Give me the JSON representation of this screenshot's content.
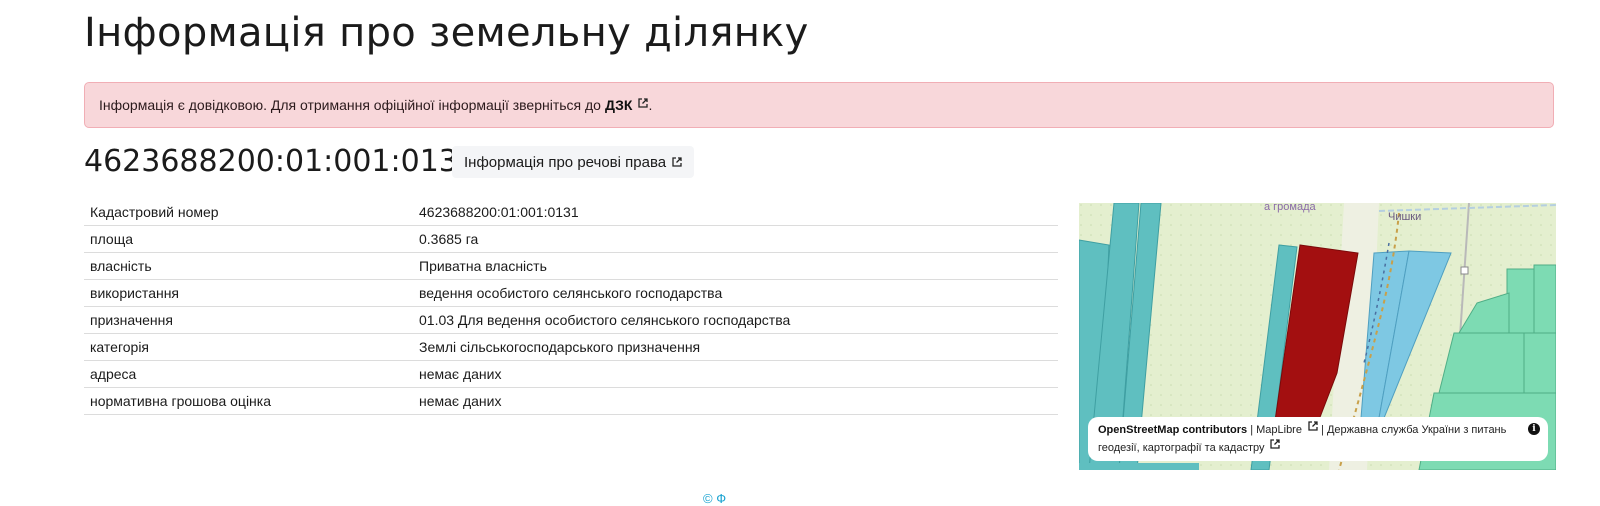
{
  "page": {
    "title": "Інформація про земельну ділянку"
  },
  "alert": {
    "text": "Інформація є довідковою. Для отримання офіційної інформації зверніться до",
    "link": "ДЗК",
    "tail": "."
  },
  "parcel": {
    "cadastral_number": "4623688200:01:001:0131",
    "rights_button": "Інформація про речові права"
  },
  "table": {
    "rows": [
      {
        "key": "Кадастровий номер",
        "value": "4623688200:01:001:0131"
      },
      {
        "key": "площа",
        "value": "0.3685 га"
      },
      {
        "key": "власність",
        "value": "Приватна власність"
      },
      {
        "key": "використання",
        "value": "ведення особистого селянського господарства"
      },
      {
        "key": "призначення",
        "value": "01.03 Для ведення особистого селянського господарства"
      },
      {
        "key": "категорія",
        "value": "Землі сільськогосподарського призначення"
      },
      {
        "key": "адреса",
        "value": "немає даних"
      },
      {
        "key": "нормативна грошова оцінка",
        "value": "немає даних"
      }
    ]
  },
  "map": {
    "label_hromada": "а громада",
    "label_village": "Чишки",
    "attribution": {
      "osm": "OpenStreetMap contributors",
      "sep1": "|",
      "maplibre": "MapLibre",
      "sep2": "|",
      "agency": "Державна служба України з питань геодезії, картографії та кадастру"
    },
    "info_icon": "i"
  },
  "footer": {
    "mark": "© Ф"
  },
  "colors": {
    "alert_bg": "#f8d7da",
    "parcel_selected": "#a30f10",
    "parcel_teal": "#5fbfc0",
    "parcel_blue": "#7ec8e3",
    "parcel_green": "#7ddbb3"
  }
}
